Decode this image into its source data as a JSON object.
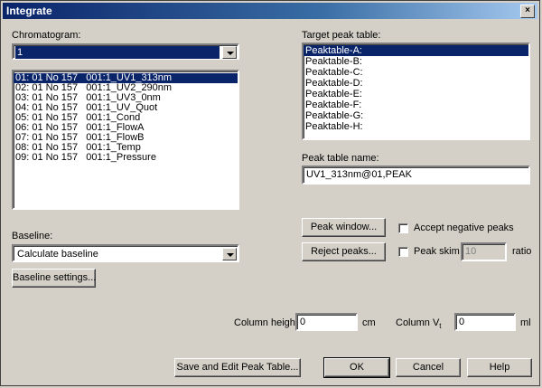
{
  "window": {
    "title": "Integrate",
    "close_glyph": "×"
  },
  "chromatogram": {
    "label": "Chromatogram:",
    "selected": "1",
    "curves": [
      "01: 01 No 157   001:1_UV1_313nm",
      "02: 01 No 157   001:1_UV2_290nm",
      "03: 01 No 157   001:1_UV3_0nm",
      "04: 01 No 157   001:1_UV_Quot",
      "05: 01 No 157   001:1_Cond",
      "06: 01 No 157   001:1_FlowA",
      "07: 01 No 157   001:1_FlowB",
      "08: 01 No 157   001:1_Temp",
      "09: 01 No 157   001:1_Pressure"
    ]
  },
  "target": {
    "label": "Target peak table:",
    "tables": [
      "Peaktable-A:",
      "Peaktable-B:",
      "Peaktable-C:",
      "Peaktable-D:",
      "Peaktable-E:",
      "Peaktable-F:",
      "Peaktable-G:",
      "Peaktable-H:"
    ]
  },
  "peak_table_name": {
    "label": "Peak table name:",
    "value": "UV1_313nm@01,PEAK"
  },
  "buttons": {
    "peak_window": "Peak window...",
    "reject_peaks": "Reject peaks...",
    "baseline_settings": "Baseline settings...",
    "save_edit": "Save and Edit Peak Table...",
    "ok": "OK",
    "cancel": "Cancel",
    "help": "Help"
  },
  "options": {
    "accept_negative": "Accept negative peaks",
    "peak_skim": "Peak skim",
    "peak_skim_value": "10",
    "ratio": "ratio"
  },
  "baseline": {
    "label": "Baseline:",
    "selected": "Calculate baseline"
  },
  "column": {
    "height_label": "Column height:",
    "height_value": "0",
    "height_unit": "cm",
    "volume_label": "Column V",
    "volume_sub": "t",
    "volume_value": "0",
    "volume_unit": "ml"
  }
}
